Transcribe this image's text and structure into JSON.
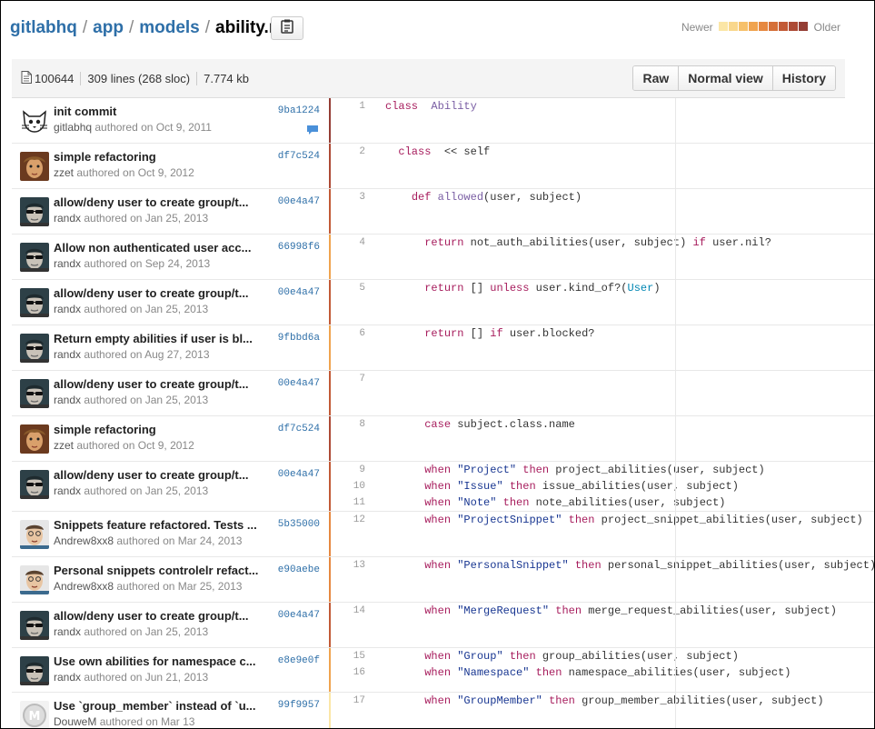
{
  "breadcrumb": {
    "project": "gitlabhq",
    "dir1": "app",
    "dir2": "models",
    "file": "ability.rb",
    "sep": "/"
  },
  "legend": {
    "newer": "Newer",
    "older": "Older",
    "colors": [
      "#fbe6a6",
      "#f9d78c",
      "#f6c06a",
      "#f0a34e",
      "#e68840",
      "#d56f38",
      "#c25a36",
      "#ad4a35",
      "#943d34"
    ]
  },
  "filebar": {
    "mode": "100644",
    "lines": "309 lines (268 sloc)",
    "size": "7.774 kb",
    "raw_label": "Raw",
    "normal_label": "Normal view",
    "history_label": "History"
  },
  "blocks": [
    {
      "title": "init commit",
      "author": "gitlabhq",
      "authored": "authored on Oct 9, 2011",
      "sha": "9ba1224",
      "avatar": "cat",
      "bar": "#943d34",
      "nums": [
        "1"
      ],
      "comment": true
    },
    {
      "title": "simple refactoring",
      "author": "zzet",
      "authored": "authored on Oct 9, 2012",
      "sha": "df7c524",
      "avatar": "zzet",
      "bar": "#ad4a35",
      "nums": [
        "2"
      ]
    },
    {
      "title": "allow/deny user to create group/t...",
      "author": "randx",
      "authored": "authored on Jan 25, 2013",
      "sha": "00e4a47",
      "avatar": "randx",
      "bar": "#c25a36",
      "nums": [
        "3"
      ]
    },
    {
      "title": "Allow non authenticated user acc...",
      "author": "randx",
      "authored": "authored on Sep 24, 2013",
      "sha": "66998f6",
      "avatar": "randx",
      "bar": "#f0a34e",
      "nums": [
        "4"
      ]
    },
    {
      "title": "allow/deny user to create group/t...",
      "author": "randx",
      "authored": "authored on Jan 25, 2013",
      "sha": "00e4a47",
      "avatar": "randx",
      "bar": "#c25a36",
      "nums": [
        "5"
      ]
    },
    {
      "title": "Return empty abilities if user is bl...",
      "author": "randx",
      "authored": "authored on Aug 27, 2013",
      "sha": "9fbbd6a",
      "avatar": "randx",
      "bar": "#f0a34e",
      "nums": [
        "6"
      ]
    },
    {
      "title": "allow/deny user to create group/t...",
      "author": "randx",
      "authored": "authored on Jan 25, 2013",
      "sha": "00e4a47",
      "avatar": "randx",
      "bar": "#c25a36",
      "nums": [
        "7"
      ]
    },
    {
      "title": "simple refactoring",
      "author": "zzet",
      "authored": "authored on Oct 9, 2012",
      "sha": "df7c524",
      "avatar": "zzet",
      "bar": "#ad4a35",
      "nums": [
        "8"
      ]
    },
    {
      "title": "allow/deny user to create group/t...",
      "author": "randx",
      "authored": "authored on Jan 25, 2013",
      "sha": "00e4a47",
      "avatar": "randx",
      "bar": "#c25a36",
      "nums": [
        "9",
        "10",
        "11"
      ]
    },
    {
      "title": "Snippets feature refactored. Tests ...",
      "author": "Andrew8xx8",
      "authored": "authored on Mar 24, 2013",
      "sha": "5b35000",
      "avatar": "andrew",
      "bar": "#e68840",
      "nums": [
        "12"
      ]
    },
    {
      "title": "Personal snippets controlelr refact...",
      "author": "Andrew8xx8",
      "authored": "authored on Mar 25, 2013",
      "sha": "e90aebe",
      "avatar": "andrew",
      "bar": "#e68840",
      "nums": [
        "13"
      ]
    },
    {
      "title": "allow/deny user to create group/t...",
      "author": "randx",
      "authored": "authored on Jan 25, 2013",
      "sha": "00e4a47",
      "avatar": "randx",
      "bar": "#c25a36",
      "nums": [
        "14"
      ]
    },
    {
      "title": "Use own abilities for namespace c...",
      "author": "randx",
      "authored": "authored on Jun 21, 2013",
      "sha": "e8e9e0f",
      "avatar": "randx",
      "bar": "#f0a34e",
      "nums": [
        "15",
        "16"
      ]
    },
    {
      "title": "Use `group_member` instead of `u...",
      "author": "DouweM",
      "authored": "authored on Mar 13",
      "sha": "99f9957",
      "avatar": "douwe",
      "bar": "#fbe6a6",
      "nums": [
        "17"
      ]
    }
  ],
  "code": [
    [
      [
        "kw",
        "class"
      ],
      [
        "",
        "  "
      ],
      [
        "cn",
        "Ability"
      ]
    ],
    [
      [
        "",
        "  "
      ],
      [
        "kw",
        "class"
      ],
      [
        "",
        "  << self"
      ]
    ],
    [
      [
        "",
        "    "
      ],
      [
        "kw",
        "def"
      ],
      [
        "",
        ""
      ],
      [
        "fn",
        " allowed"
      ],
      [
        "",
        "(user, subject)"
      ]
    ],
    [
      [
        "",
        "      "
      ],
      [
        "kw",
        "return"
      ],
      [
        "",
        " not_auth_abilities(user, subject) "
      ],
      [
        "kw",
        "if"
      ],
      [
        "",
        " user.nil?"
      ]
    ],
    [
      [
        "",
        "      "
      ],
      [
        "kw",
        "return"
      ],
      [
        "",
        " [] "
      ],
      [
        "kw",
        "unless"
      ],
      [
        "",
        " user.kind_of?("
      ],
      [
        "ct",
        "User"
      ],
      [
        "",
        ")"
      ]
    ],
    [
      [
        "",
        "      "
      ],
      [
        "kw",
        "return"
      ],
      [
        "",
        " [] "
      ],
      [
        "kw",
        "if"
      ],
      [
        "",
        " user.blocked?"
      ]
    ],
    [],
    [
      [
        "",
        "      "
      ],
      [
        "kw",
        "case"
      ],
      [
        "",
        " subject.class.name"
      ]
    ],
    [
      [
        "",
        "      "
      ],
      [
        "kw",
        "when"
      ],
      [
        "",
        ""
      ],
      [
        "str",
        " \"Project\""
      ],
      [
        "",
        " "
      ],
      [
        "kw",
        "then"
      ],
      [
        "",
        " project_abilities(user, subject)"
      ]
    ],
    [
      [
        "",
        "      "
      ],
      [
        "kw",
        "when"
      ],
      [
        "str",
        " \"Issue\""
      ],
      [
        "",
        " "
      ],
      [
        "kw",
        "then"
      ],
      [
        "",
        " issue_abilities(user, subject)"
      ]
    ],
    [
      [
        "",
        "      "
      ],
      [
        "kw",
        "when"
      ],
      [
        "str",
        " \"Note\""
      ],
      [
        "",
        " "
      ],
      [
        "kw",
        "then"
      ],
      [
        "",
        " note_abilities(user, subject)"
      ]
    ],
    [
      [
        "",
        "      "
      ],
      [
        "kw",
        "when"
      ],
      [
        "str",
        " \"ProjectSnippet\""
      ],
      [
        "",
        " "
      ],
      [
        "kw",
        "then"
      ],
      [
        "",
        " project_snippet_abilities(user, subject)"
      ]
    ],
    [
      [
        "",
        "      "
      ],
      [
        "kw",
        "when"
      ],
      [
        "str",
        " \"PersonalSnippet\""
      ],
      [
        "",
        " "
      ],
      [
        "kw",
        "then"
      ],
      [
        "",
        " personal_snippet_abilities(user, subject)"
      ]
    ],
    [
      [
        "",
        "      "
      ],
      [
        "kw",
        "when"
      ],
      [
        "str",
        " \"MergeRequest\""
      ],
      [
        "",
        " "
      ],
      [
        "kw",
        "then"
      ],
      [
        "",
        " merge_request_abilities(user, subject)"
      ]
    ],
    [
      [
        "",
        "      "
      ],
      [
        "kw",
        "when"
      ],
      [
        "str",
        " \"Group\""
      ],
      [
        "",
        " "
      ],
      [
        "kw",
        "then"
      ],
      [
        "",
        " group_abilities(user, subject)"
      ]
    ],
    [
      [
        "",
        "      "
      ],
      [
        "kw",
        "when"
      ],
      [
        "str",
        " \"Namespace\""
      ],
      [
        "",
        " "
      ],
      [
        "kw",
        "then"
      ],
      [
        "",
        " namespace_abilities(user, subject)"
      ]
    ],
    [
      [
        "",
        "      "
      ],
      [
        "kw",
        "when"
      ],
      [
        "str",
        " \"GroupMember\""
      ],
      [
        "",
        " "
      ],
      [
        "kw",
        "then"
      ],
      [
        "",
        " group_member_abilities(user, subject)"
      ]
    ]
  ]
}
